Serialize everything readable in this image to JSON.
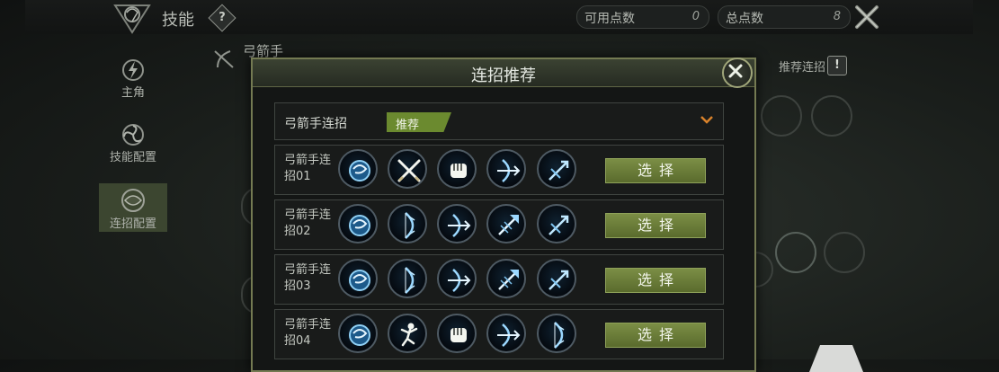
{
  "header": {
    "title": "技能",
    "help_icon": "?",
    "available_points_label": "可用点数",
    "available_points_value": "0",
    "total_points_label": "总点数",
    "total_points_value": "8"
  },
  "sidebar": {
    "items": [
      {
        "label": "主角",
        "icon": "lightning-emblem-icon",
        "active": false
      },
      {
        "label": "技能配置",
        "icon": "spiral-emblem-icon",
        "active": false
      },
      {
        "label": "连招配置",
        "icon": "combo-emblem-icon",
        "active": true
      }
    ]
  },
  "class_panel": {
    "class_name": "弓箭手",
    "recommend_label": "推荐连招",
    "warn_icon": "!"
  },
  "modal": {
    "title": "连招推荐",
    "dropdown": {
      "label": "弓箭手连招",
      "tag": "推荐"
    },
    "rows": [
      {
        "label": "弓箭手连招01",
        "button": "选择",
        "skills": [
          "wind-orb-icon",
          "crossed-swords-icon",
          "fist-icon",
          "bow-arrow-icon",
          "arrow-slash-icon"
        ]
      },
      {
        "label": "弓箭手连招02",
        "button": "选择",
        "skills": [
          "wind-orb-icon",
          "bow-icon",
          "bow-arrow-icon",
          "arrow-burst-icon",
          "arrow-slash-icon"
        ]
      },
      {
        "label": "弓箭手连招03",
        "button": "选择",
        "skills": [
          "wind-orb-icon",
          "bow-icon",
          "bow-arrow-icon",
          "arrow-burst-icon",
          "arrow-slash-icon"
        ]
      },
      {
        "label": "弓箭手连招04",
        "button": "选择",
        "skills": [
          "wind-orb-icon",
          "leaping-figure-icon",
          "fist-icon",
          "bow-arrow-icon",
          "bow-icon"
        ]
      }
    ]
  },
  "colors": {
    "accent_green": "#6b8a2f",
    "skill_glow": "#7fc4f0",
    "modal_border": "#747a52"
  }
}
